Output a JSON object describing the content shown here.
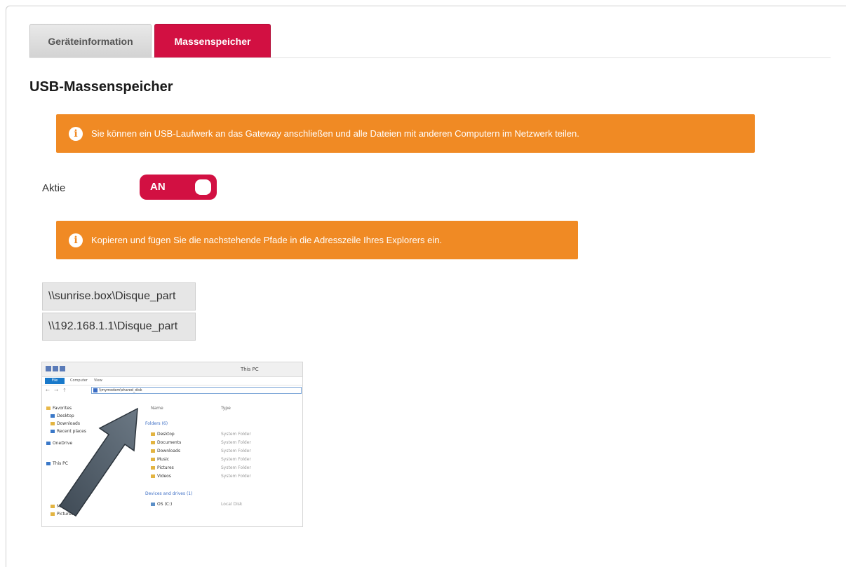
{
  "tabs": [
    {
      "label": "Geräteinformation",
      "active": false
    },
    {
      "label": "Massenspeicher",
      "active": true
    }
  ],
  "page_title": "USB-Massenspeicher",
  "info_alert_1": "Sie können ein USB-Laufwerk an das Gateway anschließen und alle Dateien mit anderen Computern im Netzwerk teilen.",
  "active_label": "Aktie",
  "toggle": {
    "label": "AN",
    "state": "on"
  },
  "info_alert_2": "Kopieren und fügen Sie die nachstehende Pfade in die Adresszeile Ihres Explorers ein.",
  "paths": [
    "\\\\sunrise.box\\Disque_part",
    "\\\\192.168.1.1\\Disque_part"
  ],
  "info_icon_glyph": "i",
  "colors": {
    "accent_red": "#d21042",
    "alert_orange": "#f08a24"
  },
  "explorer": {
    "title": "This PC",
    "ribbon": {
      "file": "File",
      "computer": "Computer",
      "view": "View"
    },
    "nav_arrows": "← → ↑",
    "address": "\\\\mymodem\\shared_disk",
    "sidebar": [
      "Favorites",
      "Desktop",
      "Downloads",
      "Recent places",
      "OneDrive",
      "This PC",
      "Music",
      "Pictures"
    ],
    "columns": {
      "name": "Name",
      "type": "Type"
    },
    "folders_group": "Folders (6)",
    "folders": [
      {
        "name": "Desktop",
        "type": "System Folder"
      },
      {
        "name": "Documents",
        "type": "System Folder"
      },
      {
        "name": "Downloads",
        "type": "System Folder"
      },
      {
        "name": "Music",
        "type": "System Folder"
      },
      {
        "name": "Pictures",
        "type": "System Folder"
      },
      {
        "name": "Videos",
        "type": "System Folder"
      }
    ],
    "devices_group": "Devices and drives (1)",
    "drive": {
      "name": "OS (C:)",
      "type": "Local Disk"
    }
  }
}
